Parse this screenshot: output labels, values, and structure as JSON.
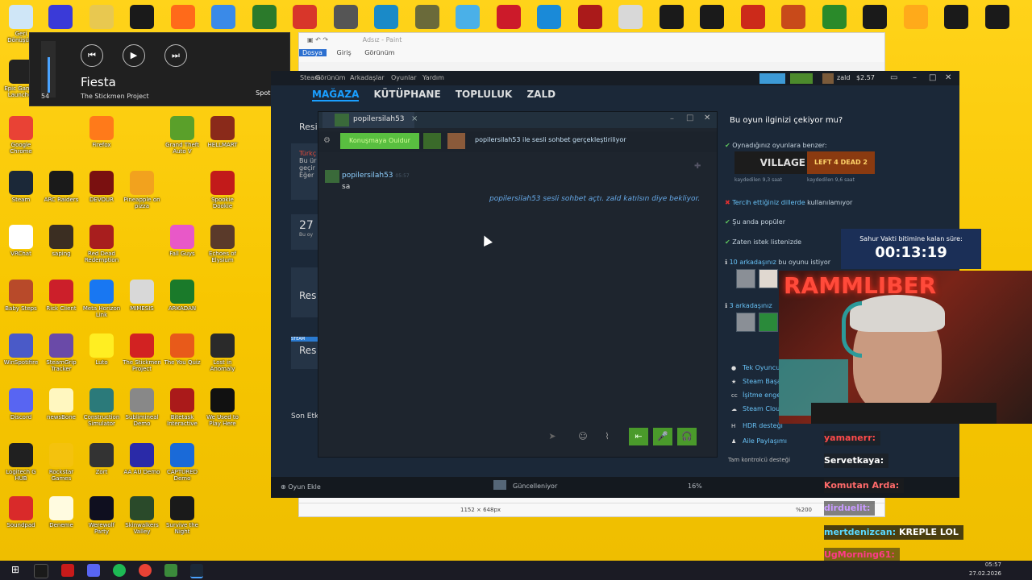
{
  "desktop": {
    "icons": [
      {
        "label": "Geri Dönüşüm",
        "color": "#cfe6f7"
      },
      {
        "label": "Epic Games Launcher",
        "color": "#222222"
      },
      {
        "label": "Google Chrome",
        "color": "#e94235"
      },
      {
        "label": "Steam",
        "color": "#1b2838"
      },
      {
        "label": "VRChat",
        "color": "#ffffff"
      },
      {
        "label": "Baby Steps",
        "color": "#b84a2a"
      },
      {
        "label": "WinSpotifire",
        "color": "#4a5ac8"
      },
      {
        "label": "Discord",
        "color": "#5865f2"
      },
      {
        "label": "Logitech G HUB",
        "color": "#202020"
      },
      {
        "label": "Soundpad",
        "color": "#d92a2a"
      },
      {
        "label": "ARC Raiders",
        "color": "#1a1a1a"
      },
      {
        "label": "saping",
        "color": "#3b2e22"
      },
      {
        "label": "Rick Client",
        "color": "#cc1f2a"
      },
      {
        "label": "SteamGrip Tracker",
        "color": "#6a4aa8"
      },
      {
        "label": "newsBone",
        "color": "#fff7c0"
      },
      {
        "label": "Rockstar Games",
        "color": "#f4c20d"
      },
      {
        "label": "Deneme",
        "color": "#fffbe0"
      },
      {
        "label": "Firefox",
        "color": "#ff7a1a"
      },
      {
        "label": "DEVOUR",
        "color": "#7a1010"
      },
      {
        "label": "Red Dead Redemption",
        "color": "#a81e1e"
      },
      {
        "label": "Meta Horizon Link",
        "color": "#1877f2"
      },
      {
        "label": "Luto",
        "color": "#ffee22"
      },
      {
        "label": "Construction Simulator",
        "color": "#2b7a7a"
      },
      {
        "label": "Zort",
        "color": "#333333"
      },
      {
        "label": "Werewolf Party",
        "color": "#0f0f1f"
      },
      {
        "label": "Pineapple on pizza",
        "color": "#f2a21e"
      },
      {
        "label": "MIMESIS",
        "color": "#d8d8d8"
      },
      {
        "label": "The Stickmen Project",
        "color": "#d22222"
      },
      {
        "label": "Sublimineal Demo",
        "color": "#888888"
      },
      {
        "label": "AA AU Demo",
        "color": "#2a2aa8"
      },
      {
        "label": "Skinwalkers Valley",
        "color": "#2a4a2a"
      },
      {
        "label": "Grand Theft Auto V",
        "color": "#5aa02a"
      },
      {
        "label": "Fall Guys",
        "color": "#e858c8"
      },
      {
        "label": "ARKADAN",
        "color": "#1a7a2a"
      },
      {
        "label": "The You Quiz",
        "color": "#e85a1a"
      },
      {
        "label": "Bitetask Interactive",
        "color": "#aa1a1a"
      },
      {
        "label": "CAPTURED Demo",
        "color": "#1a6ad8"
      },
      {
        "label": "Survive the Night",
        "color": "#1a1a1a"
      },
      {
        "label": "HELLMART",
        "color": "#8a2a1a"
      },
      {
        "label": "Spookie Dookie",
        "color": "#c21a1a"
      },
      {
        "label": "Echoes of Elysium",
        "color": "#5a3a2a"
      },
      {
        "label": "Lost in Anomaly",
        "color": "#2a2a2a"
      },
      {
        "label": "We Used to Play Here",
        "color": "#111111"
      }
    ],
    "top_row_icons": [
      "#3a3ad8",
      "#e8c850",
      "#1a1a1a",
      "#ff6a1a",
      "#3a8ae8",
      "#2b7a2b",
      "#d8362a",
      "#555555",
      "#1a8ac8",
      "#6a6a3a",
      "#4ab0e8",
      "#cc1a2a",
      "#1a8ad8",
      "#aa1a1a",
      "#d8d8d8",
      "#1a1a1a",
      "#1a1a1a",
      "#cc2a1a",
      "#c84a1a",
      "#2a8a2a",
      "#1a1a1a",
      "#ffaa1a",
      "#1a1a1a",
      "#1a1a1a",
      "#c81a1a",
      "#c81a1a"
    ]
  },
  "spotify": {
    "volume": "54",
    "track": "Fiesta",
    "artist": "The Stickmen Project",
    "brand": "Spotify",
    "prev": "⏮",
    "play": "▶",
    "next": "⏭"
  },
  "paint": {
    "title": "Adsız - Paint",
    "tabs": [
      "Dosya",
      "Giriş",
      "Görünüm"
    ],
    "canvas_size": "1152 × 648px",
    "zoom": "%200"
  },
  "steam": {
    "menu": [
      "Steam",
      "Görünüm",
      "Arkadaşlar",
      "Oyunlar",
      "Yardım"
    ],
    "user": "zald",
    "balance": "$2.57",
    "nav": [
      "MAĞAZA",
      "KÜTÜPHANE",
      "TOPLULUK",
      "ZALD"
    ],
    "left_partial": {
      "res": "Resi",
      "turk": "Türkç",
      "buur": "Bu ür",
      "gecir": "geçir",
      "eger": "Eğer",
      "n27": "27",
      "buoy": "Bu oy",
      "res2": "Res",
      "res3": "Res",
      "steam_tag": "STEAM",
      "sonetk": "Son Etk"
    },
    "chat": {
      "tab_name": "popilersilah53",
      "close": "×",
      "voice_button": "Konuşmaya Ouidur",
      "voice_text": "popilersilah53 ile sesli sohbet gerçekleştiriliyor",
      "message_author": "popilersilah53",
      "message_time": "05:57",
      "message": "sa",
      "system_message": "popilersilah53 sesli sohbet açtı. zald katılsın diye bekliyor.",
      "send": "➤",
      "emoji": "☺",
      "attach": "⌇",
      "leave": "⇤",
      "mic": "🎤",
      "headset": "🎧"
    },
    "store": {
      "question": "Bu oyun ilginizi çekiyor mu?",
      "similar": "Oynadığınız oyunlara benzer:",
      "village": "VILLAGE",
      "left4dead": "LEFT 4 DEAD 2",
      "played1": "kaydedilen 9,3 saat",
      "played2": "kaydedilen 9,6 saat",
      "lang_red": "Tercih ettiğiniz dillerde",
      "lang_rest": " kullanılamıyor",
      "popular": "Şu anda popüler",
      "wishlist": "Zaten istek listenizde",
      "friends_want": "10 arkadaşınız",
      "friends_want_rest": " bu oyunu istiyor",
      "friends_have": "3 arkadaşınız",
      "features": [
        "Tek Oyunculu",
        "Steam Başarımları",
        "İşitme engelliler",
        "Steam Cloud",
        "HDR desteği",
        "Aile Paylaşımı"
      ],
      "controller": "Tam kontrolcü desteği"
    },
    "bottom": {
      "add_game": "Oyun Ekle",
      "updating": "Güncelleniyor",
      "percent": "16%"
    }
  },
  "stream": {
    "timer_label": "Sahur Vakti bitimine kalan süre:",
    "timer": "00:13:19",
    "neon": "RAMMLIBER",
    "chat": [
      {
        "user": "yamanerr:",
        "color": "#ff4a4a"
      },
      {
        "user": "Servetkaya:",
        "color": "#ffffff"
      },
      {
        "user": "Komutan Arda:",
        "color": "#ff6a6a"
      },
      {
        "user": "dirduelit:",
        "color": "#c89aff"
      },
      {
        "user": "mertdenizcan:",
        "msg": " KREPLE LOL",
        "color": "#5ad8ff"
      },
      {
        "user": "UgMorning61:",
        "color": "#ff3a8a"
      }
    ]
  },
  "taskbar": {
    "time": "05:57",
    "date": "27.02.2026"
  }
}
